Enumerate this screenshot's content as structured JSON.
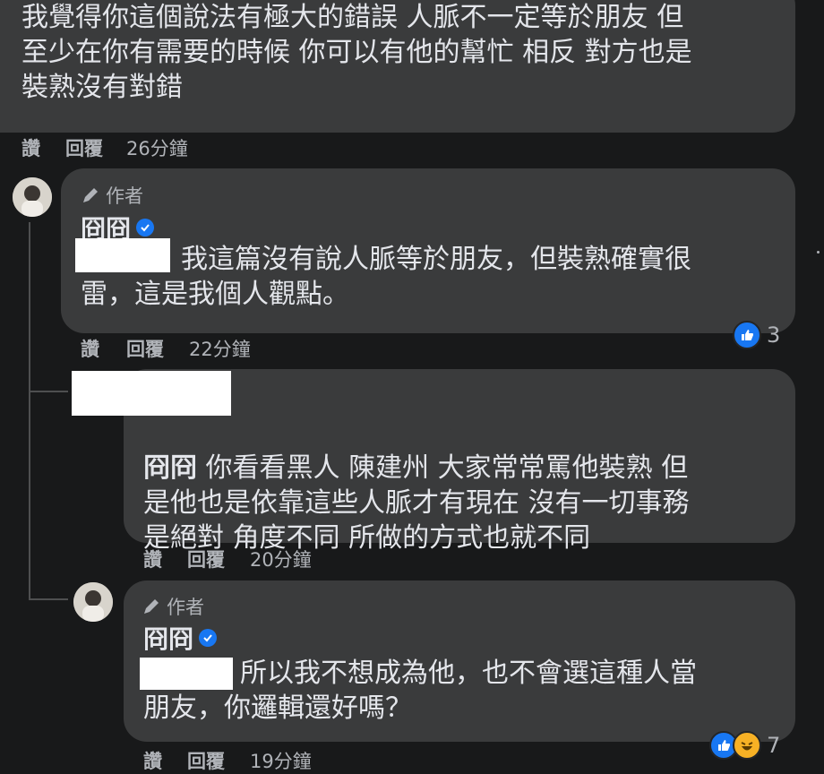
{
  "comments": [
    {
      "text": "我覺得你這個說法有極大的錯誤 人脈不一定等於朋友 但\n至少在你有需要的時候 你可以有他的幫忙 相反 對方也是\n裝熟沒有對錯",
      "like_label": "讚",
      "reply_label": "回覆",
      "time": "26分鐘"
    },
    {
      "author_tag": "作者",
      "name": "冏冏",
      "text": "我這篇沒有說人脈等於朋友，但裝熟確實很\n雷，這是我個人觀點。",
      "like_label": "讚",
      "reply_label": "回覆",
      "time": "22分鐘",
      "reaction_count": "3"
    },
    {
      "mention": "冏冏",
      "text": "你看看黑人 陳建州 大家常常罵他裝熟 但\n是他也是依靠這些人脈才有現在 沒有一切事務\n是絕對 角度不同 所做的方式也就不同",
      "like_label": "讚",
      "reply_label": "回覆",
      "time": "20分鐘"
    },
    {
      "author_tag": "作者",
      "name": "冏冏",
      "text": "所以我不想成為他，也不會選這種人當\n朋友，你邏輯還好嗎？",
      "like_label": "讚",
      "reply_label": "回覆",
      "time": "19分鐘",
      "reaction_count": "7"
    }
  ],
  "colors": {
    "background": "#18191a",
    "bubble": "#3a3b3c",
    "text": "#e4e6eb",
    "secondary_text": "#b0b3b8",
    "accent": "#1877f2"
  },
  "icons": [
    "pencil-icon",
    "verified-badge-icon",
    "like-reaction-icon",
    "haha-reaction-icon"
  ]
}
